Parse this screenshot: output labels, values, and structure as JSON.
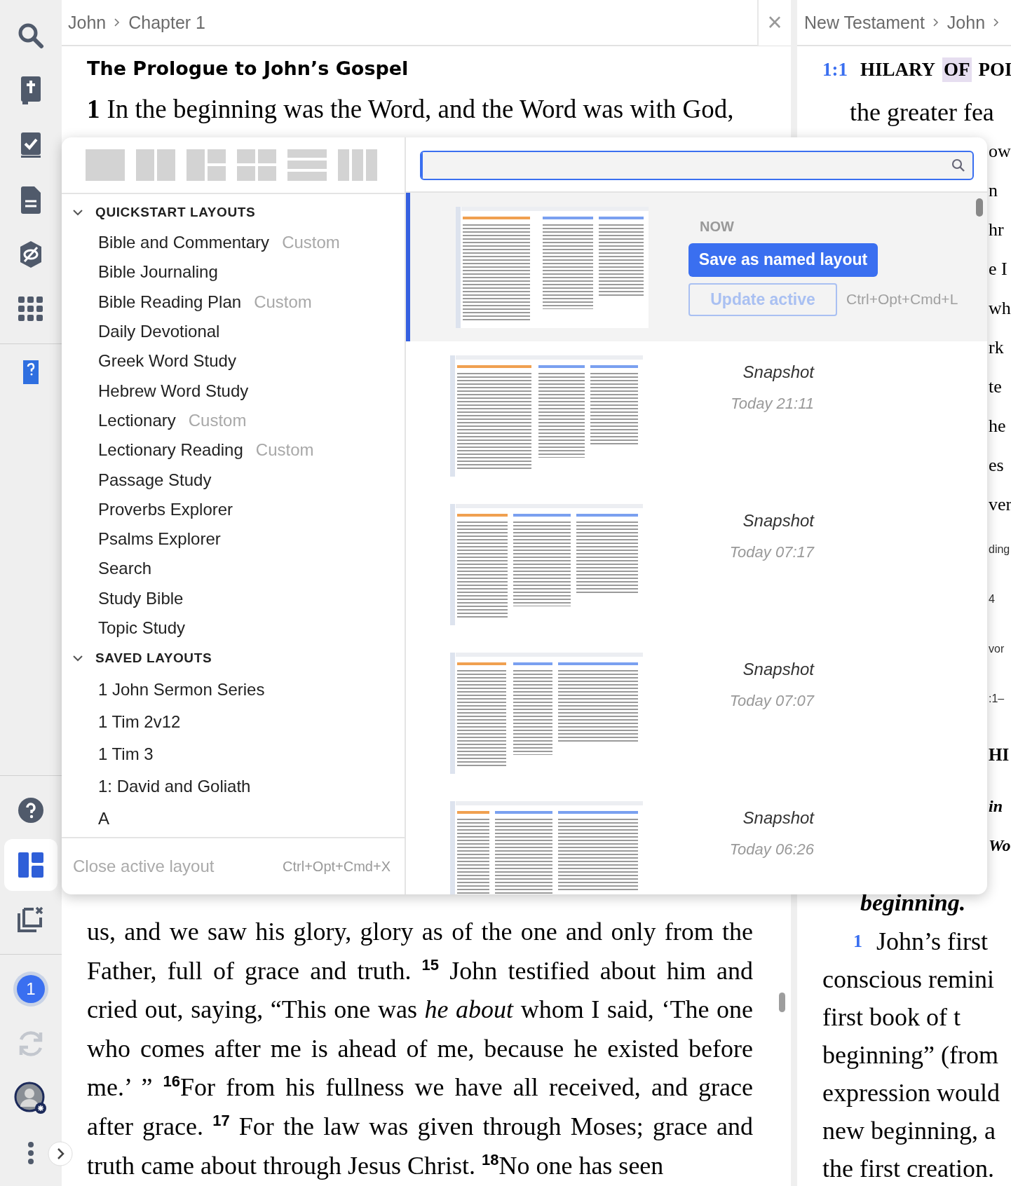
{
  "sidebar": {
    "bottom_buttons": [
      {
        "selected": false
      },
      {
        "selected": true
      },
      {
        "selected": false
      }
    ],
    "badge": "1"
  },
  "main_panel": {
    "breadcrumb": [
      "John",
      "Chapter 1"
    ],
    "close": "×",
    "heading": "The Prologue to John’s Gospel",
    "verse_number": "1",
    "verse_text": "In the beginning was the Word, and the Word was with God,",
    "passage": "us, and we saw his glory, glory as of the one and only from the Father, full of grace and truth. $^{15}$ John testified about him and cried out, saying, “This one was *he about* whom I said, ‘The one who comes after me is ahead of me, because he existed before me.’ ” $^{16}$For from his fullness we have all received, and grace after grace. $^{17}$ For the law was given through Moses; grace and truth came about through Jesus Christ. $^{18}$No one has seen"
  },
  "right_panel": {
    "breadcrumb": [
      "New Testament",
      "John"
    ],
    "reference": "1:1",
    "heading_words": [
      {
        "text": "HILARY",
        "highlighted": false
      },
      {
        "text": "OF",
        "highlighted": true
      },
      {
        "text": "POI",
        "highlighted": false
      }
    ],
    "first_line": "the greater fea",
    "peek_lines": [
      {
        "text": "ow",
        "kind": "serif"
      },
      {
        "text": "n",
        "kind": "serif"
      },
      {
        "text": "hr",
        "kind": "serif"
      },
      {
        "text": "e I",
        "kind": "serif"
      },
      {
        "text": "wh",
        "kind": "serif"
      },
      {
        "text": "rk",
        "kind": "serif"
      },
      {
        "text": "te",
        "kind": "serif"
      },
      {
        "text": "he",
        "kind": "serif"
      },
      {
        "text": "es",
        "kind": "serif"
      },
      {
        "text": "ver",
        "kind": "serif"
      },
      {
        "text": "ding",
        "kind": "sans"
      },
      {
        "text": "4",
        "kind": "sans"
      },
      {
        "text": "vor",
        "kind": "sans"
      },
      {
        "text": ":1–",
        "kind": "sans"
      },
      {
        "text": "HI",
        "kind": "heading"
      },
      {
        "text": "in",
        "kind": "italic"
      },
      {
        "text": "Wo",
        "kind": "italic"
      }
    ],
    "covered_line": "beginning.",
    "commentary_verse": "1",
    "commentary_lines": [
      "John’s first",
      "conscious remini",
      "first book of t",
      "beginning” (from",
      "expression would",
      "new beginning, a",
      "the first creation."
    ]
  },
  "layout_picker": {
    "layout_tiles": [
      {
        "kind": "single"
      },
      {
        "kind": "two-columns"
      },
      {
        "kind": "three-pane"
      },
      {
        "kind": "four-grid"
      },
      {
        "kind": "rows"
      },
      {
        "kind": "three-columns"
      }
    ],
    "sections": [
      {
        "title": "QUICKSTART LAYOUTS",
        "expanded": true,
        "items": [
          {
            "label": "Bible and Commentary",
            "tag": "Custom"
          },
          {
            "label": "Bible Journaling"
          },
          {
            "label": "Bible Reading Plan",
            "tag": "Custom"
          },
          {
            "label": "Daily Devotional"
          },
          {
            "label": "Greek Word Study"
          },
          {
            "label": "Hebrew Word Study"
          },
          {
            "label": "Lectionary",
            "tag": "Custom"
          },
          {
            "label": "Lectionary Reading",
            "tag": "Custom"
          },
          {
            "label": "Passage Study"
          },
          {
            "label": "Proverbs Explorer"
          },
          {
            "label": "Psalms Explorer"
          },
          {
            "label": "Search"
          },
          {
            "label": "Study Bible"
          },
          {
            "label": "Topic Study"
          }
        ]
      },
      {
        "title": "SAVED LAYOUTS",
        "expanded": true,
        "items": [
          {
            "label": "1 John Sermon Series"
          },
          {
            "label": "1 Tim 2v12"
          },
          {
            "label": "1 Tim 3"
          },
          {
            "label": "1: David and Goliath"
          },
          {
            "label": "A"
          }
        ]
      }
    ],
    "footer": {
      "label": "Close active layout",
      "shortcut": "Ctrl+Opt+Cmd+X"
    },
    "current": {
      "label": "NOW",
      "selected": true,
      "save_button": "Save as named layout",
      "update_button": "Update active",
      "update_disabled": true,
      "shortcut": "Ctrl+Opt+Cmd+L"
    },
    "snapshots": [
      {
        "label": "Snapshot",
        "time": "Today 21:11",
        "selected": false
      },
      {
        "label": "Snapshot",
        "time": "Today 07:17",
        "selected": false
      },
      {
        "label": "Snapshot",
        "time": "Today 07:07",
        "selected": false
      },
      {
        "label": "Snapshot",
        "time": "Today 06:26",
        "selected": false
      }
    ]
  }
}
